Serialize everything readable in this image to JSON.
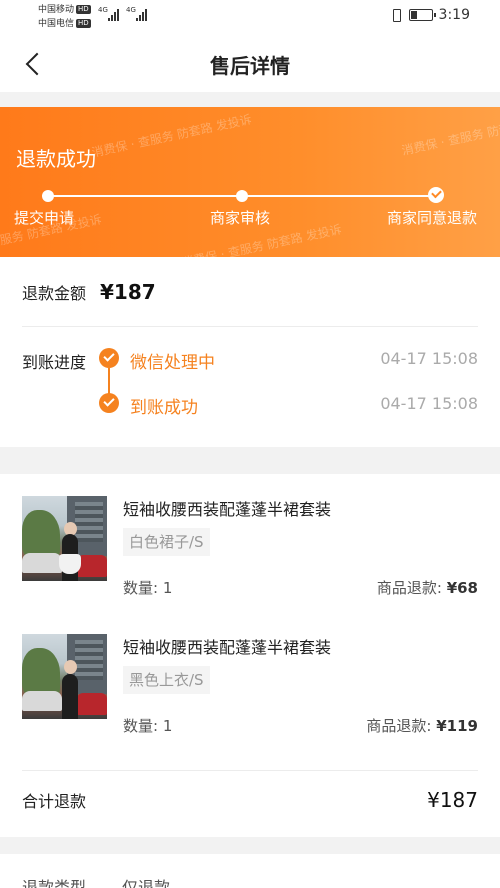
{
  "statusbar": {
    "carrier1": "中国移动",
    "carrier2": "中国电信",
    "hd": "HD",
    "net": "4G",
    "time": "3:19",
    "battery_level": 0.35
  },
  "nav": {
    "title": "售后详情",
    "back_icon": "chevron-left-icon"
  },
  "hero": {
    "title": "退款成功",
    "watermark": "消费保 · 查服务 防套路 发投诉",
    "steps": [
      "提交申请",
      "商家审核",
      "商家同意退款"
    ],
    "colors": {
      "from": "#ff7a1a",
      "to": "#ffa046"
    }
  },
  "refund": {
    "amount_label": "退款金额",
    "amount_value": "¥187",
    "progress_label": "到账进度",
    "progress": [
      {
        "text": "微信处理中",
        "time": "04-17 15:08"
      },
      {
        "text": "到账成功",
        "time": "04-17 15:08"
      }
    ]
  },
  "items": [
    {
      "name": "短袖收腰西装配蓬蓬半裙套装",
      "sku": "白色裙子/S",
      "qty": "数量: 1",
      "refund_label": "商品退款:",
      "refund_value": "¥68"
    },
    {
      "name": "短袖收腰西装配蓬蓬半裙套装",
      "sku": "黑色上衣/S",
      "qty": "数量: 1",
      "refund_label": "商品退款:",
      "refund_value": "¥119"
    }
  ],
  "total": {
    "label": "合计退款",
    "value": "¥187"
  },
  "info": {
    "type_label": "退款类型",
    "type_value": "仅退款"
  },
  "accent": "#f5821f"
}
